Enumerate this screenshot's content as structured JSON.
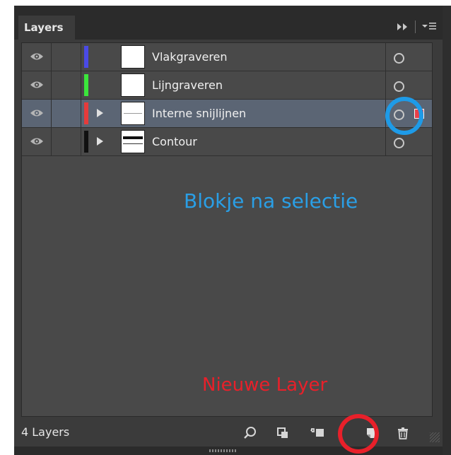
{
  "panel": {
    "tab_title": "Layers",
    "footer_count": "4 Layers"
  },
  "layers": [
    {
      "name": "Vlakgraveren",
      "color": "#4a4ae6",
      "expandable": false,
      "selected": false,
      "thumb": "blank"
    },
    {
      "name": "Lijngraveren",
      "color": "#3be63b",
      "expandable": false,
      "selected": false,
      "thumb": "blank"
    },
    {
      "name": "Interne snijlijnen",
      "color": "#e63b3b",
      "expandable": true,
      "selected": true,
      "thumb": "dashed"
    },
    {
      "name": "Contour",
      "color": "#111111",
      "expandable": true,
      "selected": false,
      "thumb": "contour"
    }
  ],
  "annotations": {
    "selection_note": "Blokje na selectie",
    "new_layer_note": "Nieuwe Layer",
    "selection_color": "#1e9be8",
    "new_layer_color": "#e8202a"
  },
  "footer_buttons": [
    {
      "icon": "search-icon"
    },
    {
      "icon": "make-clipping-mask-icon"
    },
    {
      "icon": "create-sublayer-icon"
    },
    {
      "icon": "new-layer-icon"
    },
    {
      "icon": "trash-icon"
    }
  ],
  "colors": {
    "panel_bg": "#3b3b3b",
    "list_bg": "#494949",
    "selected_row": "#5b6574",
    "selection_square": "#e8404a"
  }
}
